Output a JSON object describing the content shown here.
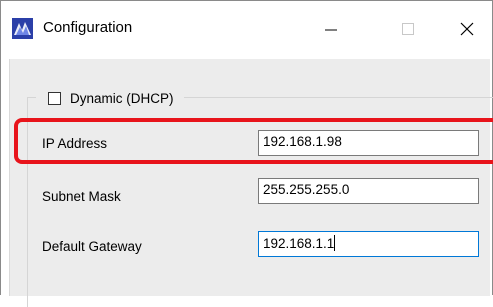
{
  "window": {
    "title": "Configuration",
    "app_icon": "app-logo-icon",
    "controls": {
      "minimize_icon": "minimize-icon",
      "maximize_icon": "maximize-icon",
      "close_icon": "close-icon"
    }
  },
  "form": {
    "dhcp": {
      "label": "Dynamic (DHCP)",
      "checked": false
    },
    "ip_address": {
      "label": "IP Address",
      "value": "192.168.1.98"
    },
    "subnet_mask": {
      "label": "Subnet Mask",
      "value": "255.255.255.0"
    },
    "default_gateway": {
      "label": "Default Gateway",
      "value": "192.168.1.1"
    }
  },
  "colors": {
    "highlight": "#e8141b",
    "focus_border": "#0078d7",
    "client_background": "#ececec"
  }
}
